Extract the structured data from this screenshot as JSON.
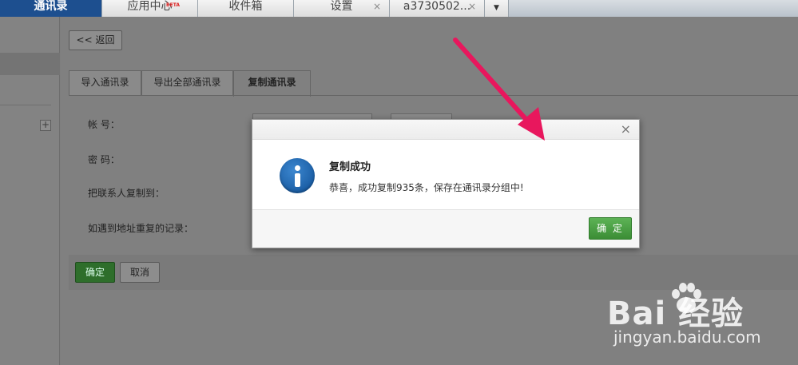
{
  "tabs": [
    {
      "label": "通讯录",
      "active": true
    },
    {
      "label": "应用中心",
      "badge": "BETA"
    },
    {
      "label": "收件箱"
    },
    {
      "label": "设置",
      "closable": true
    },
    {
      "label": "a3730502...",
      "closable": true
    }
  ],
  "tab_close_glyph": "×",
  "tab_dropdown_icon": "chevron-down-icon",
  "back_button": "<< 返回",
  "content_tabs": [
    {
      "label": "导入通讯录"
    },
    {
      "label": "导出全部通讯录"
    },
    {
      "label": "复制通讯录",
      "active": true
    }
  ],
  "form": {
    "account_label": "帐 号：",
    "password_label": "密 码：",
    "copy_to_label": "把联系人复制到：",
    "duplicate_label": "如遇到地址重复的记录："
  },
  "footer": {
    "ok": "确定",
    "cancel": "取消"
  },
  "dialog": {
    "title": "复制成功",
    "message": "恭喜，成功复制935条，保存在通讯录分组中!",
    "confirm": "确 定",
    "close_glyph": "×",
    "icon": "info-icon"
  },
  "sidebar": {
    "add_glyph": "+"
  },
  "watermark": {
    "logo": "Bai  经验",
    "url": "jingyan.baidu.com"
  },
  "colors": {
    "active_tab": "#1d4f8f",
    "confirm_green": "#3b8d35",
    "arrow": "#e8175d",
    "info_blue": "#1a5fa8"
  }
}
